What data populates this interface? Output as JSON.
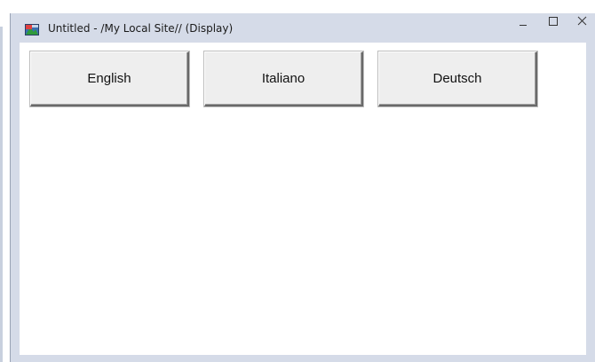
{
  "window": {
    "title": "Untitled - /My Local Site// (Display)",
    "app_icon": "display-app-icon",
    "controls": {
      "minimize_icon": "minimize-icon",
      "maximize_icon": "maximize-icon",
      "close_icon": "close-icon"
    }
  },
  "buttons": [
    {
      "label": "English"
    },
    {
      "label": "Italiano"
    },
    {
      "label": "Deutsch"
    }
  ],
  "colors": {
    "titlebar": "#d5dbe8",
    "client": "#ffffff",
    "button_face": "#eeeeee"
  }
}
